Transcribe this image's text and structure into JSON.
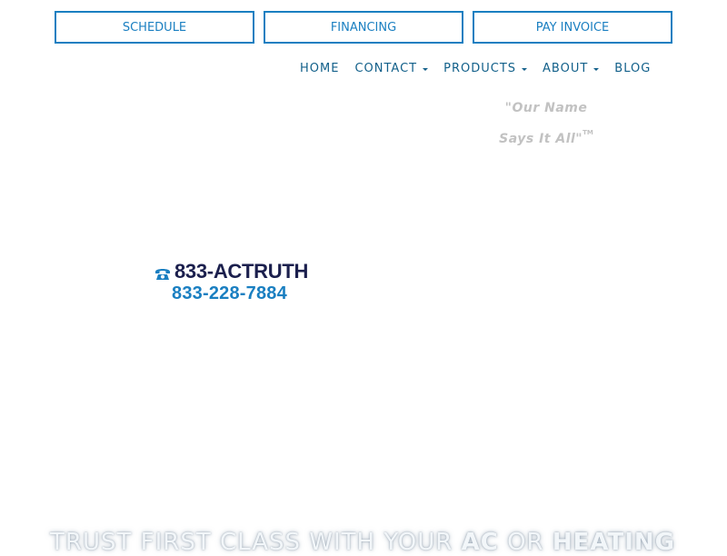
{
  "top_buttons": {
    "schedule": "SCHEDULE",
    "financing": "FINANCING",
    "pay_invoice": "PAY INVOICE"
  },
  "nav": {
    "home": "HOME",
    "contact": "CONTACT",
    "products": "PRODUCTS",
    "about": "ABOUT",
    "blog": "BLOG"
  },
  "tagline": {
    "line1": "\"Our Name",
    "line2": "Says It All\"",
    "trademark": "TM"
  },
  "phone": {
    "icon": "phone-icon",
    "vanity": "833-ACTRUTH",
    "number": "833-228-7884"
  },
  "hero": {
    "part1": "Trust First Class with your",
    "bold1": "AC",
    "part2": "or",
    "bold2": "Heating"
  },
  "colors": {
    "accent": "#1a7fc1",
    "nav_text": "#12608a",
    "phone_dark": "#1b1f4d",
    "tagline": "#c2c2c2"
  }
}
